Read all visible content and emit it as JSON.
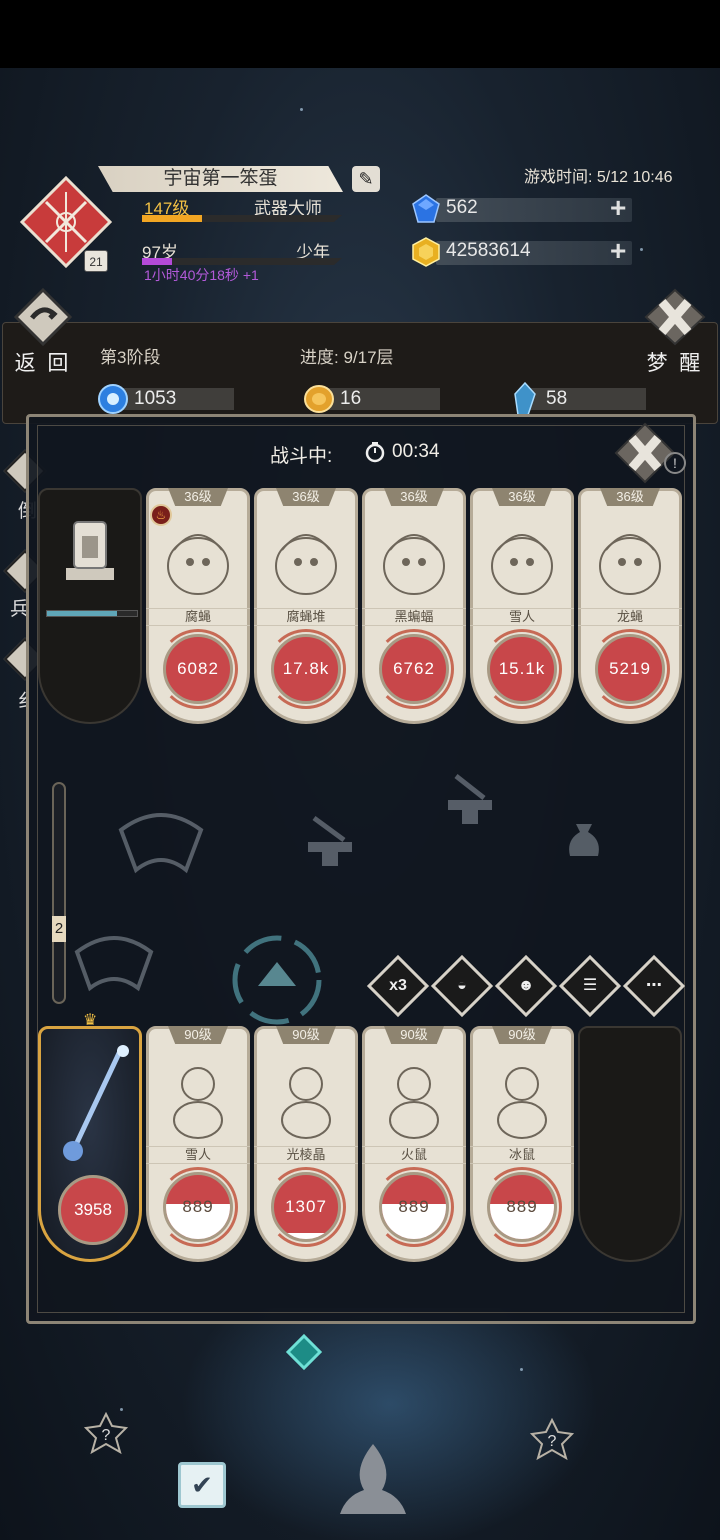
{
  "player": {
    "name": "宇宙第一笨蛋",
    "avatar_level": "21",
    "level": "147级",
    "title": "武器大师",
    "level_progress": 0.3,
    "age": "97岁",
    "age_stage": "少年",
    "age_progress": 0.15,
    "age_timer": "1小时40分18秒 +1"
  },
  "game_time": "游戏时间: 5/12 10:46",
  "currency": {
    "blue_gem": "562",
    "gold_gem": "42583614"
  },
  "stage": {
    "back_label": "返 回",
    "stage_label": "第3阶段",
    "progress_label": "进度: 9/17层",
    "wake_label": "梦 醒",
    "resources": [
      {
        "icon": "blue-orb-icon",
        "value": "1053"
      },
      {
        "icon": "gold-coin-icon",
        "value": "16"
      },
      {
        "icon": "crystal-icon",
        "value": "58"
      }
    ]
  },
  "side_buttons": [
    {
      "label": "倒"
    },
    {
      "label": "兵"
    },
    {
      "label": "纟"
    }
  ],
  "battle": {
    "status": "战斗中:",
    "time": "00:34",
    "player_mp_progress": 0.78,
    "gauge_value": "2",
    "enemies": [
      {
        "level": "36级",
        "name": "腐蝇",
        "hp": "6082",
        "hp_ratio": 0.0
      },
      {
        "level": "36级",
        "name": "腐蝇堆",
        "hp": "17.8k",
        "hp_ratio": 0.0
      },
      {
        "level": "36级",
        "name": "黑蝙蝠",
        "hp": "6762",
        "hp_ratio": 0.0
      },
      {
        "level": "36级",
        "name": "雪人",
        "hp": "15.1k",
        "hp_ratio": 0.0
      },
      {
        "level": "36级",
        "name": "龙蝇",
        "hp": "5219",
        "hp_ratio": 0.0
      }
    ],
    "hero_hp": "3958",
    "allies": [
      {
        "level": "90级",
        "name": "雪人",
        "hp": "889",
        "hp_ratio": 0.55
      },
      {
        "level": "90级",
        "name": "光棱晶",
        "hp": "1307",
        "hp_ratio": 0.1
      },
      {
        "level": "90级",
        "name": "火鼠",
        "hp": "889",
        "hp_ratio": 0.55
      },
      {
        "level": "90级",
        "name": "冰鼠",
        "hp": "889",
        "hp_ratio": 0.55
      }
    ],
    "skills": [
      {
        "icon": "speed-x3-icon",
        "label": "x3"
      },
      {
        "icon": "auto-icon",
        "label": ""
      },
      {
        "icon": "mask-icon",
        "label": ""
      },
      {
        "icon": "log-icon",
        "label": ""
      },
      {
        "icon": "chat-icon",
        "label": ""
      }
    ]
  },
  "colors": {
    "hp_red": "#c8474a",
    "gold": "#f3c145",
    "purple": "#b44ad8"
  }
}
